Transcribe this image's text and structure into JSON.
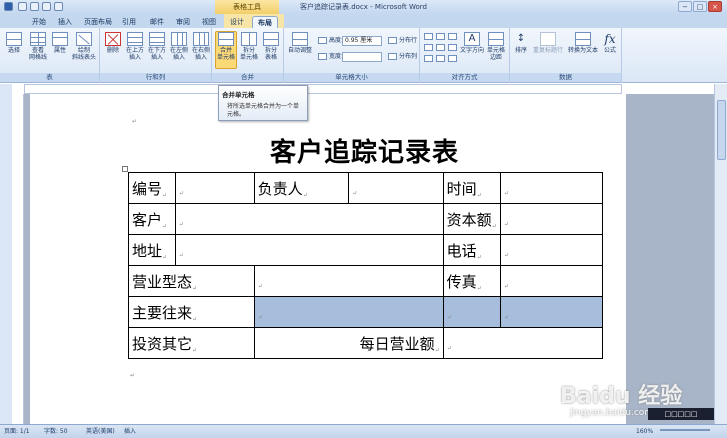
{
  "window": {
    "title": "客户追踪记录表.docx - Microsoft Word",
    "context_tab_group": "表格工具",
    "controls": [
      "−",
      "□",
      "×"
    ]
  },
  "tabs": [
    "开始",
    "插入",
    "页面布局",
    "引用",
    "邮件",
    "审阅",
    "视图",
    "设计",
    "布局"
  ],
  "active_tab": "布局",
  "ribbon": {
    "groups": {
      "table": "表",
      "rows_cols": "行和列",
      "merge": "合并",
      "cell_size": "单元格大小",
      "alignment": "对齐方式",
      "data": "数据"
    },
    "buttons": {
      "select": "选择",
      "gridlines": "查看\n网格线",
      "properties": "属性",
      "draw_diagonal": "绘制\n斜线表头",
      "delete": "删除",
      "insert_above": "在上方\n插入",
      "insert_below": "在下方\n插入",
      "insert_left": "在左侧\n插入",
      "insert_right": "在右侧\n插入",
      "merge_cells": "合并\n单元格",
      "split_cells": "拆分\n单元格",
      "split_table": "拆分\n表格",
      "autofit": "自动调整",
      "height_label": "高度:",
      "height_value": "0.95 厘米",
      "width_label": "宽度:",
      "width_value": "",
      "distribute_rows": "分布行",
      "distribute_cols": "分布列",
      "text_direction": "文字方向",
      "cell_margins": "单元格\n边距",
      "sort": "排序",
      "repeat_header": "重复标题行",
      "convert_to_text": "转换为文本",
      "formula": "公式"
    }
  },
  "tooltip": {
    "title": "合并单元格",
    "description": "将所选单元格合并为一个单元格。"
  },
  "document": {
    "title": "客户追踪记录表",
    "table": {
      "r1": {
        "c1": "编号",
        "c2": "负责人",
        "c3": "时间"
      },
      "r2": {
        "c1": "客户",
        "c2": "资本额"
      },
      "r3": {
        "c1": "地址",
        "c2": "电话"
      },
      "r4": {
        "c1": "营业型态",
        "c2": "传真"
      },
      "r5": {
        "c1": "主要往来"
      },
      "r6": {
        "c1": "投资其它",
        "c2": "每日营业额"
      }
    },
    "mark": "↵"
  },
  "statusbar": {
    "page": "页面: 1/1",
    "words": "字数: 50",
    "language": "英语(美国)",
    "mode": "插入",
    "zoom": "160%"
  },
  "watermark": {
    "logo": "Baidu 经验",
    "url": "jingyan.baidu.com"
  },
  "overlay_text": "□□□□□"
}
